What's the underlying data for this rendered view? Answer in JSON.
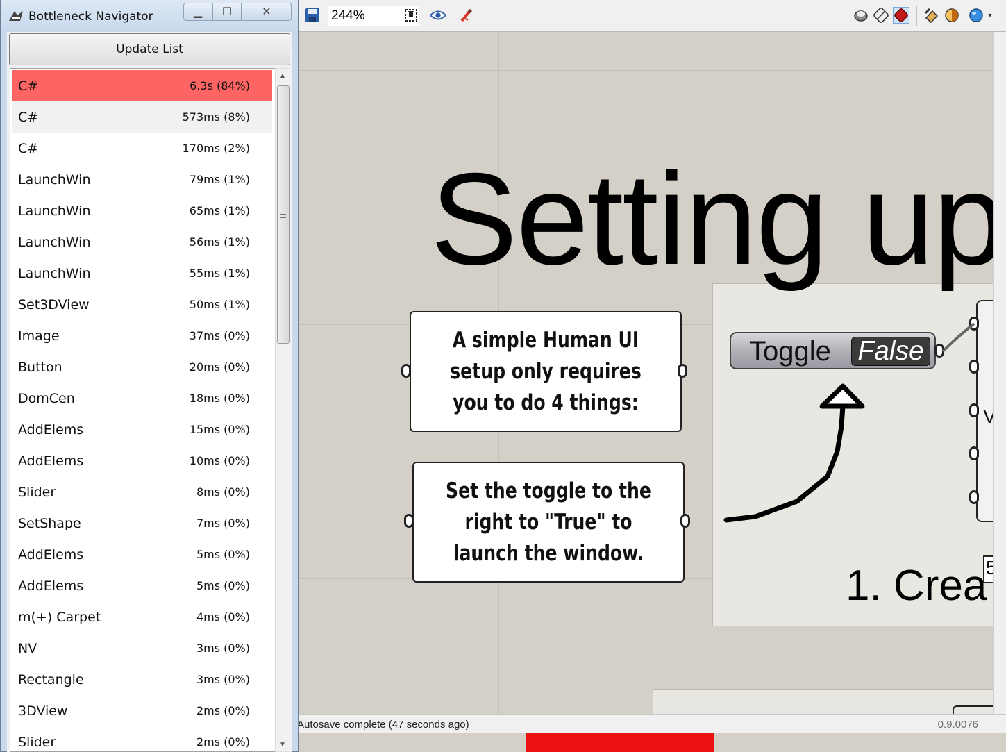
{
  "window": {
    "title": "Bottleneck Navigator",
    "app_icon": "navigator-icon",
    "update_button": "Update List"
  },
  "list": {
    "rows": [
      {
        "name": "C#",
        "time": "6.3s (84%)",
        "state": "hot"
      },
      {
        "name": "C#",
        "time": "573ms (8%)",
        "state": "warm"
      },
      {
        "name": "C#",
        "time": "170ms (2%)",
        "state": ""
      },
      {
        "name": "LaunchWin",
        "time": "79ms (1%)",
        "state": ""
      },
      {
        "name": "LaunchWin",
        "time": "65ms (1%)",
        "state": ""
      },
      {
        "name": "LaunchWin",
        "time": "56ms (1%)",
        "state": ""
      },
      {
        "name": "LaunchWin",
        "time": "55ms (1%)",
        "state": ""
      },
      {
        "name": "Set3DView",
        "time": "50ms (1%)",
        "state": ""
      },
      {
        "name": "Image",
        "time": "37ms (0%)",
        "state": ""
      },
      {
        "name": "Button",
        "time": "20ms (0%)",
        "state": ""
      },
      {
        "name": "DomCen",
        "time": "18ms (0%)",
        "state": ""
      },
      {
        "name": "AddElems",
        "time": "15ms (0%)",
        "state": ""
      },
      {
        "name": "AddElems",
        "time": "10ms (0%)",
        "state": ""
      },
      {
        "name": "Slider",
        "time": "8ms (0%)",
        "state": ""
      },
      {
        "name": "SetShape",
        "time": "7ms (0%)",
        "state": ""
      },
      {
        "name": "AddElems",
        "time": "5ms (0%)",
        "state": ""
      },
      {
        "name": "AddElems",
        "time": "5ms (0%)",
        "state": ""
      },
      {
        "name": "m(+) Carpet",
        "time": "4ms (0%)",
        "state": ""
      },
      {
        "name": "NV",
        "time": "3ms (0%)",
        "state": ""
      },
      {
        "name": "Rectangle",
        "time": "3ms (0%)",
        "state": ""
      },
      {
        "name": "3DView",
        "time": "2ms (0%)",
        "state": ""
      },
      {
        "name": "Slider",
        "time": "2ms (0%)",
        "state": ""
      }
    ]
  },
  "canvas": {
    "zoom": "244%",
    "title": "Setting up",
    "group_label": "1. Crea",
    "note_1": "A simple Human UI setup only requires you to do 4 things:",
    "note_2": "Set the toggle to the right to \"True\" to launch the window.",
    "toggle": {
      "label": "Toggle",
      "value": "False"
    },
    "side_letter": "V",
    "side_number": "5",
    "status": "Autosave complete (47 seconds ago)",
    "version": "0.9.0076"
  },
  "colors": {
    "hot_row": "#ff6464",
    "canvas_bg": "#d4d0c8",
    "red_strip": "#ee1111"
  },
  "icons": {
    "save": "save-icon",
    "zoom_dropdown": "chevron-down-icon",
    "select": "select-tool-icon",
    "preview": "eye-icon",
    "sketch": "sketch-icon",
    "right_tools": [
      "display-icon",
      "wireframe-icon",
      "shaded-icon",
      "bake-icon",
      "material-icon",
      "sphere-icon"
    ]
  }
}
